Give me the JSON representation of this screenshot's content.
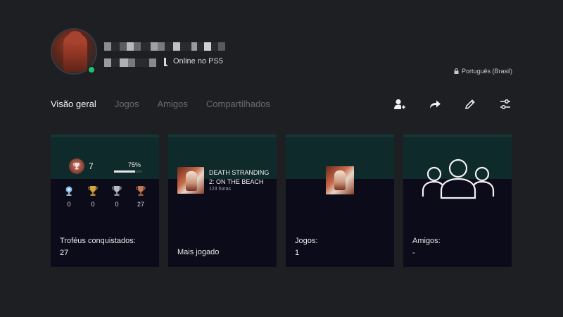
{
  "profile": {
    "status_text": "Online no PS5",
    "language": "Português (Brasil)",
    "online_color": "#1ec46a"
  },
  "tabs": [
    {
      "label": "Visão geral",
      "active": true
    },
    {
      "label": "Jogos",
      "active": false
    },
    {
      "label": "Amigos",
      "active": false
    },
    {
      "label": "Compartilhados",
      "active": false
    }
  ],
  "actions": [
    {
      "icon": "add-friend-icon"
    },
    {
      "icon": "share-icon"
    },
    {
      "icon": "edit-icon"
    },
    {
      "icon": "settings-sliders-icon"
    }
  ],
  "cards": {
    "trophies": {
      "level": "7",
      "progress_pct": "75%",
      "progress_value": 0.75,
      "counts": {
        "platinum": "0",
        "gold": "0",
        "silver": "0",
        "bronze": "27"
      },
      "label": "Troféus conquistados:",
      "value": "27"
    },
    "most_played": {
      "game_title": "DEATH STRANDING 2: ON THE BEACH",
      "hours": "123 horas",
      "label": "Mais jogado"
    },
    "games": {
      "label": "Jogos:",
      "value": "1"
    },
    "friends": {
      "label": "Amigos:",
      "value": "-"
    }
  }
}
